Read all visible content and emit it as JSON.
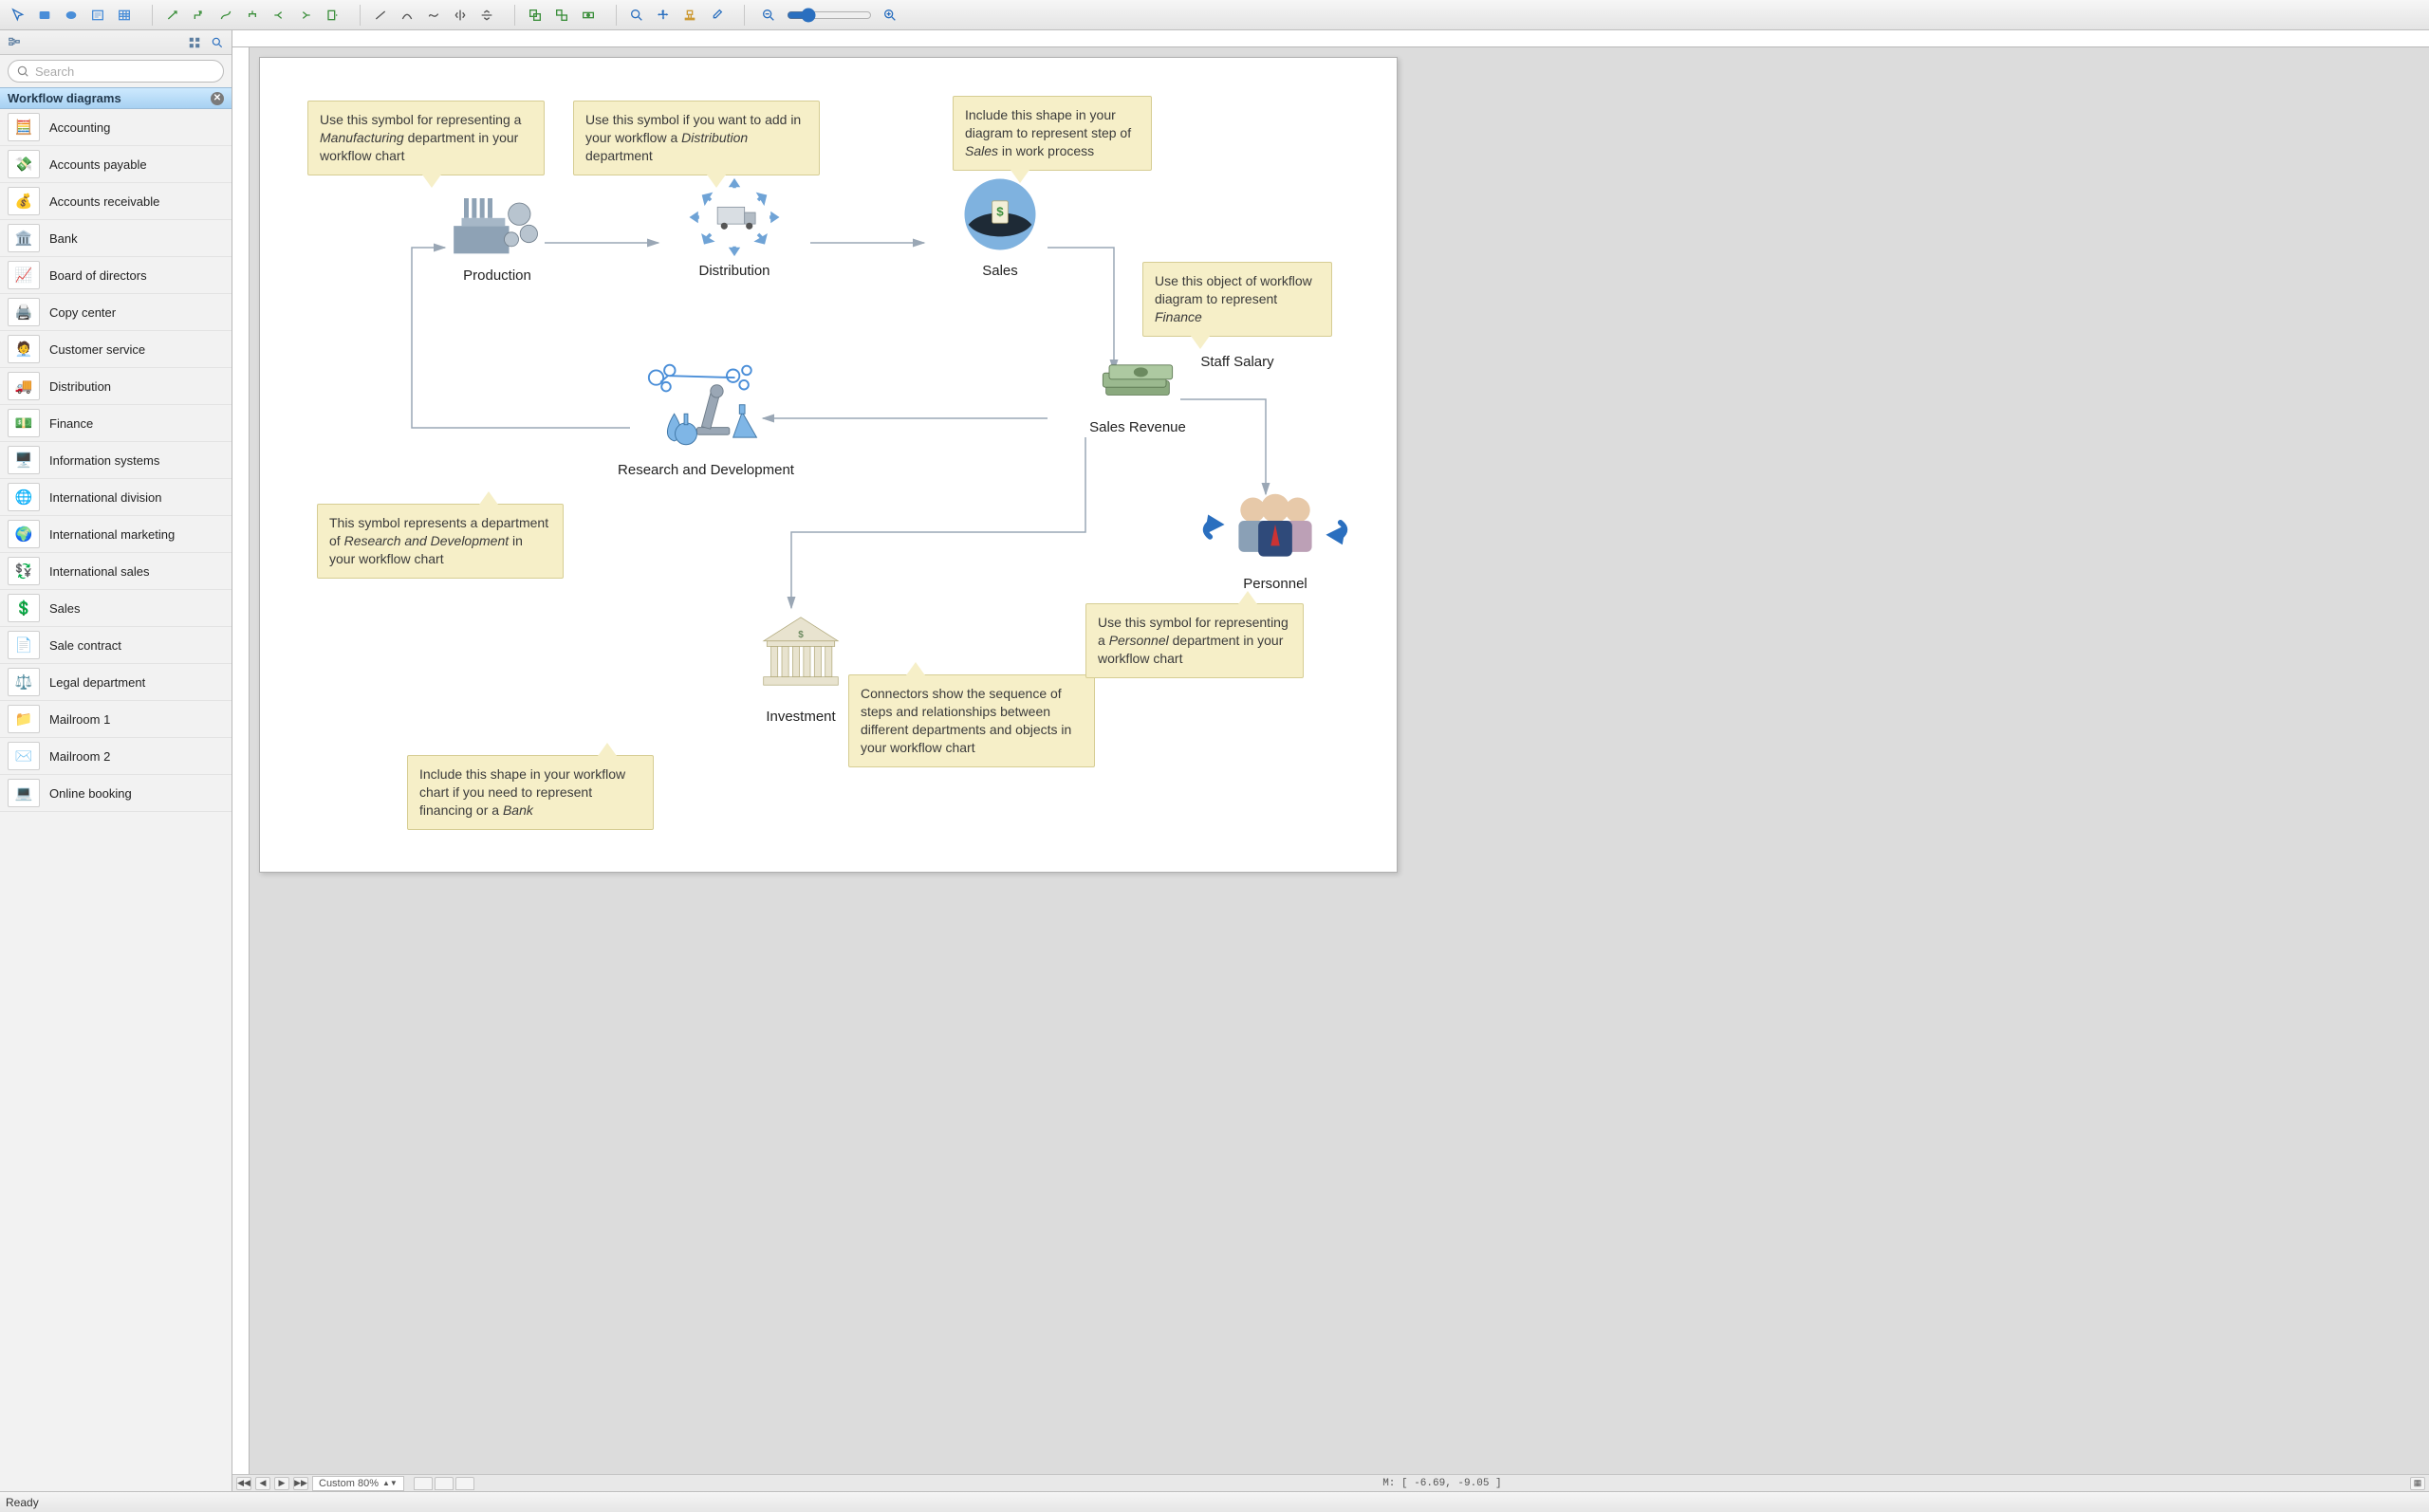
{
  "toolbar": {
    "groups": [
      [
        "pointer",
        "rect",
        "ellipse",
        "text",
        "table"
      ],
      [
        "connector-direct",
        "connector-elbow",
        "connector-curve",
        "connector-tree",
        "connector-split",
        "connector-merge",
        "connector-page"
      ],
      [
        "line",
        "arc",
        "curve",
        "rotate-cw",
        "rotate-ccw"
      ],
      [
        "align-left",
        "align-center",
        "align-right"
      ],
      [
        "zoom-in-tool",
        "pan-tool",
        "stamp-tool",
        "eyedropper"
      ]
    ],
    "zoom_minus": "−",
    "zoom_plus": "+"
  },
  "side": {
    "search_placeholder": "Search",
    "section_title": "Workflow diagrams",
    "items": [
      {
        "label": "Accounting",
        "emoji": "🧮"
      },
      {
        "label": "Accounts payable",
        "emoji": "💸"
      },
      {
        "label": "Accounts receivable",
        "emoji": "💰"
      },
      {
        "label": "Bank",
        "emoji": "🏛️"
      },
      {
        "label": "Board of directors",
        "emoji": "📈"
      },
      {
        "label": "Copy center",
        "emoji": "🖨️"
      },
      {
        "label": "Customer service",
        "emoji": "🧑‍💼"
      },
      {
        "label": "Distribution",
        "emoji": "🚚"
      },
      {
        "label": "Finance",
        "emoji": "💵"
      },
      {
        "label": "Information systems",
        "emoji": "🖥️"
      },
      {
        "label": "International division",
        "emoji": "🌐"
      },
      {
        "label": "International marketing",
        "emoji": "🌍"
      },
      {
        "label": "International sales",
        "emoji": "💱"
      },
      {
        "label": "Sales",
        "emoji": "💲"
      },
      {
        "label": "Sale contract",
        "emoji": "📄"
      },
      {
        "label": "Legal department",
        "emoji": "⚖️"
      },
      {
        "label": "Mailroom 1",
        "emoji": "📁"
      },
      {
        "label": "Mailroom 2",
        "emoji": "✉️"
      },
      {
        "label": "Online booking",
        "emoji": "💻"
      }
    ]
  },
  "diagram": {
    "nodes": {
      "production": {
        "label": "Production"
      },
      "distribution": {
        "label": "Distribution"
      },
      "sales": {
        "label": "Sales"
      },
      "revenue": {
        "label": "Sales Revenue"
      },
      "salary": {
        "label": "Staff Salary"
      },
      "rnd": {
        "label": "Research and Development"
      },
      "investment": {
        "label": "Investment"
      },
      "personnel": {
        "label": "Personnel"
      }
    },
    "callouts": {
      "production": "Use this symbol for representing a <em>Manufacturing</em> department in your workflow chart",
      "distribution": "Use this symbol if you want to add in your workflow a <em>Distribution</em> department",
      "sales": "Include this shape in your diagram to represent step of <em>Sales</em> in work process",
      "finance": "Use this object of workflow diagram to represent <em>Finance</em>",
      "rnd": "This symbol represents a department of <em>Research and Development</em> in your workflow chart",
      "investment": "Include this shape in your workflow chart if you need to represent financing or a <em>Bank</em>",
      "connectors": "Connectors show the sequence of steps and relationships between different departments and objects in your workflow chart",
      "personnel": "Use this symbol for representing a <em>Personnel</em> department in your workflow chart"
    }
  },
  "status": {
    "ready": "Ready",
    "zoom_label": "Custom 80%",
    "coords": "M: [ -6.69, -9.05 ]"
  }
}
